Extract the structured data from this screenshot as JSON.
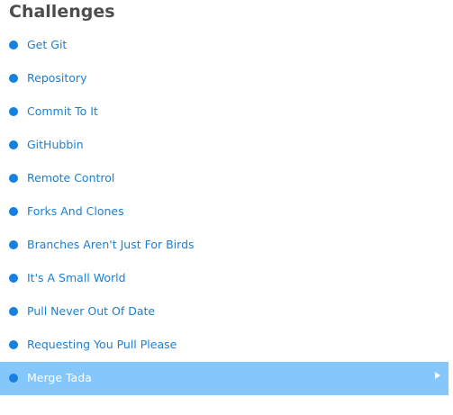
{
  "header": {
    "title": "Challenges"
  },
  "colors": {
    "title": "#4d4d4d",
    "dot": "#1580e0",
    "link": "#1b7fd3",
    "active_background": "#83c7fb",
    "active_text": "#ffffff"
  },
  "challenges": [
    {
      "label": "Get Git",
      "active": false
    },
    {
      "label": "Repository",
      "active": false
    },
    {
      "label": "Commit To It",
      "active": false
    },
    {
      "label": "GitHubbin",
      "active": false
    },
    {
      "label": "Remote Control",
      "active": false
    },
    {
      "label": "Forks And Clones",
      "active": false
    },
    {
      "label": "Branches Aren't Just For Birds",
      "active": false
    },
    {
      "label": "It's A Small World",
      "active": false
    },
    {
      "label": "Pull Never Out Of Date",
      "active": false
    },
    {
      "label": "Requesting You Pull Please",
      "active": false
    },
    {
      "label": "Merge Tada",
      "active": true
    }
  ],
  "icons": {
    "bullet": "bullet-dot-icon",
    "selected_arrow": "play-arrow-icon"
  }
}
